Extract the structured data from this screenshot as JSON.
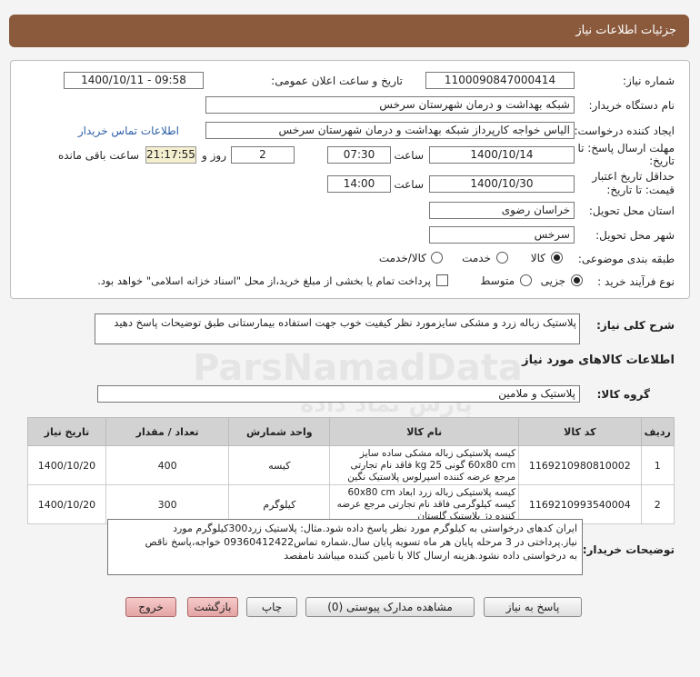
{
  "header": {
    "title": "جزئیات اطلاعات نیاز"
  },
  "fields": {
    "need_number_label": "شماره نیاز:",
    "need_number": "1100090847000414",
    "announce_label": "تاریخ و ساعت اعلان عمومی:",
    "announce_value": "1400/10/11 - 09:58",
    "buyer_org_label": "نام دستگاه خریدار:",
    "buyer_org": "شبکه بهداشت و درمان شهرستان سرخس",
    "creator_label": "ایجاد کننده درخواست:",
    "creator": "الیاس خواجه کارپرداز شبکه بهداشت و درمان شهرستان سرخس",
    "contact_link": "اطلاعات تماس خریدار",
    "deadline_label_1": "مهلت ارسال پاسخ: تا",
    "deadline_label_2": "تاریخ:",
    "deadline_date": "1400/10/14",
    "time_label": "ساعت",
    "deadline_time": "07:30",
    "days_value": "2",
    "days_label": "روز و",
    "remaining_time": "21:17:55",
    "remaining_label": "ساعت باقی مانده",
    "validity_label_1": "حداقل تاریخ اعتبار",
    "validity_label_2": "قیمت: تا تاریخ:",
    "validity_date": "1400/10/30",
    "validity_time": "14:00",
    "province_label": "استان محل تحویل:",
    "province": "خراسان رضوی",
    "city_label": "شهر محل تحویل:",
    "city": "سرخس",
    "category_label": "طبقه بندی موضوعی:",
    "category_options": [
      "کالا",
      "خدمت",
      "کالا/خدمت"
    ],
    "purchase_type_label": "نوع فرآیند خرید :",
    "purchase_options": [
      "جزیی",
      "متوسط"
    ],
    "payment_note": "پرداخت تمام یا بخشی از مبلغ خرید،از محل \"اسناد خزانه اسلامی\" خواهد بود."
  },
  "summary": {
    "label": "شرح کلی نیاز:",
    "text": "پلاستیک زباله زرد و مشکی سایزمورد نظر کیفیت خوب جهت استفاده بیمارستانی طبق توضیحات پاسخ دهید"
  },
  "goods": {
    "section_title": "اطلاعات کالاهای مورد نیاز",
    "group_label": "گروه کالا:",
    "group_value": "پلاستیک و ملامین"
  },
  "table": {
    "headers": [
      "ردیف",
      "کد کالا",
      "نام کالا",
      "واحد شمارش",
      "تعداد / مقدار",
      "تاریخ نیاز"
    ],
    "rows": [
      {
        "idx": "1",
        "code": "1169210980810002",
        "name": "کیسه پلاستیکی زباله مشکی ساده سایز 60x80 cm گونی 25 kg فاقد نام تجارتی مرجع عرضه کننده اسپرلوس پلاستیک نگین",
        "unit": "کیسه",
        "qty": "400",
        "date": "1400/10/20"
      },
      {
        "idx": "2",
        "code": "1169210993540004",
        "name": "کیسه پلاستیکی زباله زرد ابعاد 60x80 cm کیسه کیلوگرمی فاقد نام تجارتی مرجع عرضه کننده دژ پلاستیک گلستان",
        "unit": "کیلوگرم",
        "qty": "300",
        "date": "1400/10/20"
      }
    ]
  },
  "buyer_notes": {
    "label": "توضیحات خریدار:",
    "lines": [
      "ایران کدهای درخواستی به کیلوگرم مورد نظر پاسخ داده شود.مثال: پلاستیک زرد300کیلوگرم مورد",
      "نیاز.پرداختی در 3 مرحله پایان هر ماه تسویه پایان سال.شماره تماس09360412422 خواجه،پاسخ ناقص",
      "به درخواستی داده نشود.هزینه ارسال کالا با تامین کننده میباشد تامقصد"
    ]
  },
  "buttons": {
    "reply": "پاسخ به نیاز",
    "attachments": "مشاهده مدارک پیوستی (0)",
    "print": "چاپ",
    "back": "بازگشت",
    "exit": "خروج"
  },
  "watermark": {
    "brand": "ParsNamadData",
    "tagline": "پارس نماد داده"
  }
}
